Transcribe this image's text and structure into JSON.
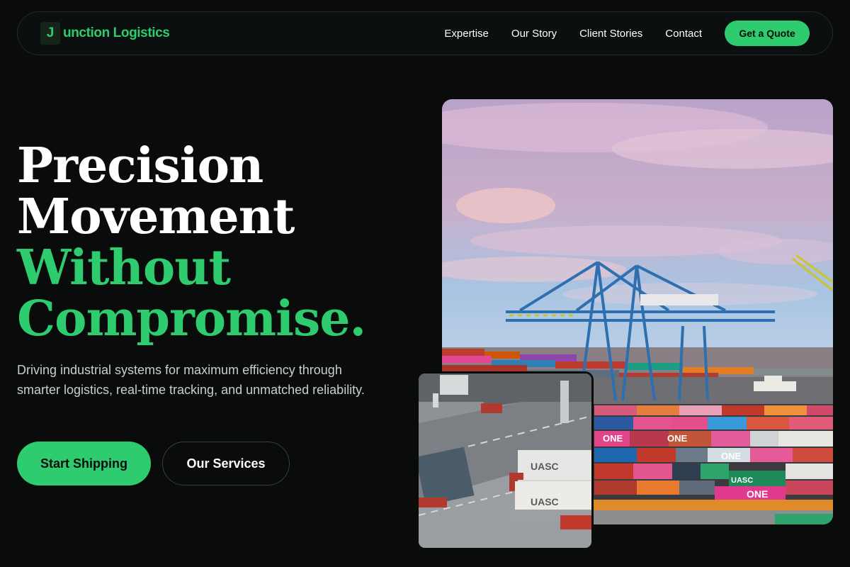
{
  "nav": {
    "logo_mark": "J",
    "logo_text": "unction Logistics",
    "links": [
      "Expertise",
      "Our Story",
      "Client Stories",
      "Contact"
    ],
    "cta": "Get a Quote"
  },
  "hero": {
    "headline_line1": "Precision",
    "headline_line2": "Movement",
    "headline_line3": "Without",
    "headline_line4": "Compromise.",
    "subtext": "Driving industrial systems for maximum efficiency through smarter logistics, real-time tracking, and unmatched reliability.",
    "primary_button": "Start Shipping",
    "secondary_button": "Our Services"
  },
  "images": {
    "main_alt": "Container port with gantry cranes",
    "inset_alt": "Trucks carrying containers at terminal"
  },
  "container_text": {
    "one": "ONE",
    "uasc": "UASC"
  },
  "colors": {
    "background": "#0a0c0c",
    "accent": "#2ecc6e",
    "text": "#ffffff",
    "muted": "#c9cfcd"
  }
}
